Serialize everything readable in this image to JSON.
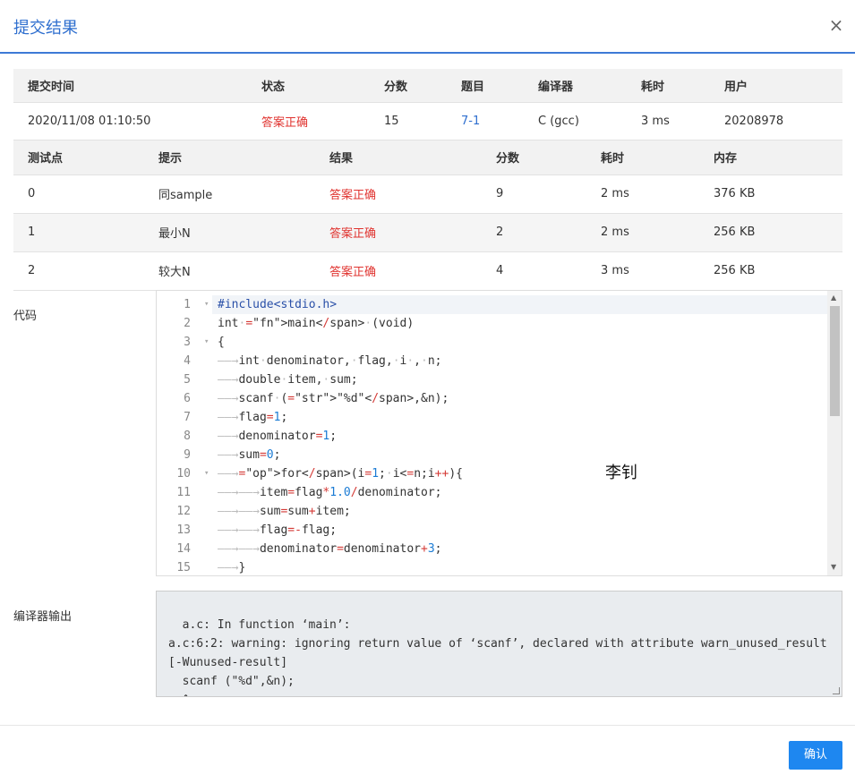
{
  "dialog": {
    "title": "提交结果",
    "close_symbol": "×"
  },
  "summary": {
    "headers": [
      "提交时间",
      "状态",
      "分数",
      "题目",
      "编译器",
      "耗时",
      "用户"
    ],
    "row": {
      "time": "2020/11/08 01:10:50",
      "status": "答案正确",
      "score": "15",
      "problem": "7-1",
      "compiler": "C (gcc)",
      "elapsed": "3 ms",
      "user": "20208978"
    }
  },
  "cases": {
    "headers": [
      "测试点",
      "提示",
      "结果",
      "分数",
      "耗时",
      "内存"
    ],
    "rows": [
      {
        "id": "0",
        "hint": "同sample",
        "result": "答案正确",
        "score": "9",
        "time": "2 ms",
        "memory": "376 KB"
      },
      {
        "id": "1",
        "hint": "最小N",
        "result": "答案正确",
        "score": "2",
        "time": "2 ms",
        "memory": "256 KB"
      },
      {
        "id": "2",
        "hint": "较大N",
        "result": "答案正确",
        "score": "4",
        "time": "3 ms",
        "memory": "256 KB"
      }
    ]
  },
  "code_label": "代码",
  "code": {
    "line_numbers": [
      "1",
      "2",
      "3",
      "4",
      "5",
      "6",
      "7",
      "8",
      "9",
      "10",
      "11",
      "12",
      "13",
      "14",
      "15"
    ],
    "lines": [
      "#include<stdio.h>",
      "int·main·(void)",
      "{",
      "——→int·denominator,·flag,·i·,·n;",
      "——→double·item,·sum;",
      "——→scanf·(\"%d\",&n);",
      "——→flag=1;",
      "——→denominator=1;",
      "——→sum=0;",
      "——→for(i=1;·i<=n;i++){",
      "——→——→item=flag*1.0/denominator;",
      "——→——→sum=sum+item;",
      "——→——→flag=-flag;",
      "——→——→denominator=denominator+3;",
      "——→}"
    ],
    "fold_marker": "▾",
    "scroll_up": "▲",
    "scroll_down": "▼"
  },
  "watermark": "李钊",
  "compiler_label": "编译器输出",
  "compiler_output": "a.c: In function ‘main’:\na.c:6:2: warning: ignoring return value of ‘scanf’, declared with attribute warn_unused_result\n[-Wunused-result]\n  scanf (\"%d\",&n);\n  ^~~~~~~~~~~~~~~",
  "footer": {
    "confirm_label": "确认"
  },
  "colors": {
    "accent": "#1e87f0",
    "title": "#2f6fcf",
    "accepted": "#e0332f"
  }
}
